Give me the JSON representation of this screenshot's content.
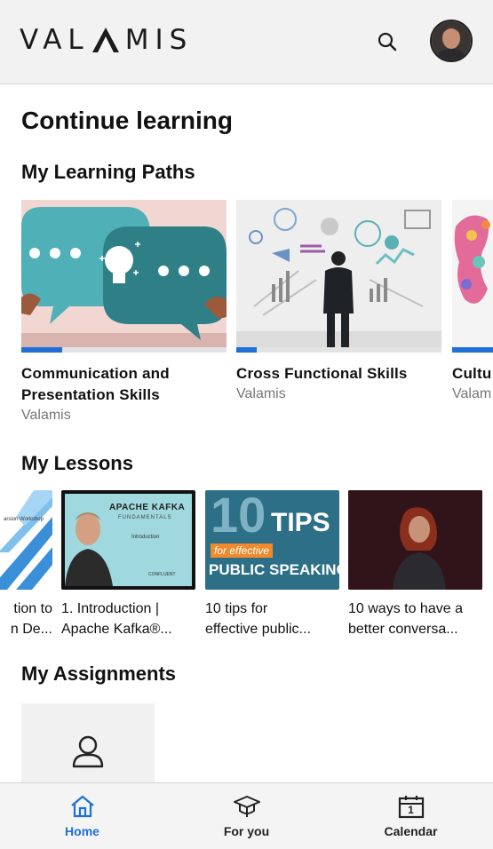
{
  "header": {
    "logo_text_left": "VAL",
    "logo_text_right": "MIS",
    "search_icon": "search-icon",
    "avatar_icon": "user-avatar"
  },
  "page_title": "Continue learning",
  "learning_paths": {
    "title": "My Learning Paths",
    "items": [
      {
        "title_line1": "Communication and",
        "title_line2": "Presentation Skills",
        "subtitle": "Valamis",
        "progress": 0.2
      },
      {
        "title_line1": "Cross Functional Skills",
        "title_line2": "",
        "subtitle": "Valamis",
        "progress": 0.1
      },
      {
        "title_line1": "Cultu",
        "title_line2": "",
        "subtitle": "Valam",
        "progress": 0.2
      }
    ]
  },
  "lessons": {
    "title": "My Lessons",
    "items": [
      {
        "line1": "tion to",
        "line2": "n De...",
        "thumb_text": "arsion Workshop"
      },
      {
        "line1": "1. Introduction |",
        "line2": "Apache Kafka®...",
        "thumb_title": "APACHE KAFKA",
        "thumb_sub": "FUNDAMENTALS",
        "thumb_intro": "Introduction",
        "thumb_brand": "CONFLUENT"
      },
      {
        "line1": "10 tips for",
        "line2": "effective public...",
        "thumb_big": "10",
        "thumb_tips": "TIPS",
        "thumb_for": "for effective",
        "thumb_banner": "PUBLIC SPEAKING"
      },
      {
        "line1": "10 ways to have a",
        "line2": "better conversa..."
      }
    ]
  },
  "assignments": {
    "title": "My Assignments",
    "icon": "person-icon"
  },
  "bottom_nav": {
    "items": [
      {
        "label": "Home",
        "icon": "home-icon",
        "active": true
      },
      {
        "label": "For you",
        "icon": "graduation-cap-icon",
        "active": false
      },
      {
        "label": "Calendar",
        "icon": "calendar-icon",
        "active": false
      }
    ],
    "calendar_day": "1"
  },
  "colors": {
    "accent": "#1f6fd6",
    "header_bg": "#f2f2f3",
    "teal": "#4fb0b7",
    "dark_teal": "#2f7f86"
  }
}
